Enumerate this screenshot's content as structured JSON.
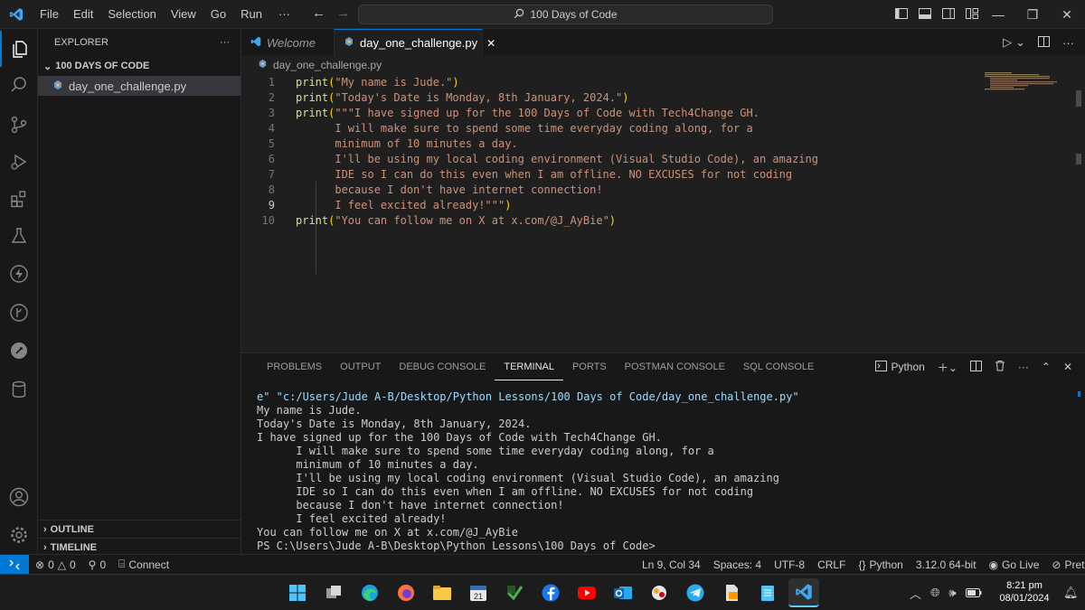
{
  "titlebar": {
    "menu": [
      "File",
      "Edit",
      "Selection",
      "View",
      "Go",
      "Run"
    ],
    "more": "···",
    "search_text": "100 Days of Code"
  },
  "sidebar": {
    "title": "EXPLORER",
    "more": "···",
    "folder": "100 DAYS OF CODE",
    "file": "day_one_challenge.py",
    "outline": "OUTLINE",
    "timeline": "TIMELINE"
  },
  "tabs": {
    "welcome": "Welcome",
    "active": "day_one_challenge.py",
    "close": "✕"
  },
  "breadcrumb": "day_one_challenge.py",
  "code": {
    "current_line": 9,
    "lines": [
      {
        "n": "1",
        "fn": "print",
        "open": "(",
        "str": "\"My name is Jude.\"",
        "close": ")"
      },
      {
        "n": "2",
        "fn": "print",
        "open": "(",
        "str": "\"Today's Date is Monday, 8th January, 2024.\"",
        "close": ")"
      },
      {
        "n": "3",
        "fn": "print",
        "open": "(",
        "str": "\"\"\"I have signed up for the 100 Days of Code with Tech4Change GH.",
        "close": ""
      },
      {
        "n": "4",
        "fn": "",
        "open": "",
        "str": "      I will make sure to spend some time everyday coding along, for a",
        "close": ""
      },
      {
        "n": "5",
        "fn": "",
        "open": "",
        "str": "      minimum of 10 minutes a day.",
        "close": ""
      },
      {
        "n": "6",
        "fn": "",
        "open": "",
        "str": "      I'll be using my local coding environment (Visual Studio Code), an amazing",
        "close": ""
      },
      {
        "n": "7",
        "fn": "",
        "open": "",
        "str": "      IDE so I can do this even when I am offline. NO EXCUSES for not coding",
        "close": ""
      },
      {
        "n": "8",
        "fn": "",
        "open": "",
        "str": "      because I don't have internet connection!",
        "close": ""
      },
      {
        "n": "9",
        "fn": "",
        "open": "",
        "str": "      I feel excited already!\"\"\"",
        "close": ")"
      },
      {
        "n": "10",
        "fn": "print",
        "open": "(",
        "str": "\"You can follow me on X at x.com/@J_AyBie\"",
        "close": ")"
      }
    ]
  },
  "panel": {
    "tabs": [
      "PROBLEMS",
      "OUTPUT",
      "DEBUG CONSOLE",
      "TERMINAL",
      "PORTS",
      "POSTMAN CONSOLE",
      "SQL CONSOLE"
    ],
    "active_tab": "TERMINAL",
    "terminal_profile": "Python",
    "terminal": [
      "e\" \"c:/Users/Jude A-B/Desktop/Python Lessons/100 Days of Code/day_one_challenge.py\"",
      "My name is Jude.",
      "Today's Date is Monday, 8th January, 2024.",
      "I have signed up for the 100 Days of Code with Tech4Change GH.",
      "      I will make sure to spend some time everyday coding along, for a",
      "      minimum of 10 minutes a day.",
      "      I'll be using my local coding environment (Visual Studio Code), an amazing",
      "      IDE so I can do this even when I am offline. NO EXCUSES for not coding",
      "      because I don't have internet connection!",
      "      I feel excited already!",
      "You can follow me on X at x.com/@J_AyBie",
      "PS C:\\Users\\Jude A-B\\Desktop\\Python Lessons\\100 Days of Code>"
    ]
  },
  "statusbar": {
    "errors": "0",
    "warnings": "0",
    "ports": "0",
    "connect": "Connect",
    "position": "Ln 9, Col 34",
    "spaces": "Spaces: 4",
    "encoding": "UTF-8",
    "eol": "CRLF",
    "language": "Python",
    "interpreter": "3.12.0 64-bit",
    "golive": "Go Live",
    "prettier": "Prettier"
  },
  "taskbar": {
    "time": "8:21 pm",
    "date": "08/01/2024",
    "calendar_day": "21"
  },
  "colors": {
    "accent": "#0078d4",
    "string": "#ce9178",
    "function": "#dcdcaa",
    "bracket": "#ffd700"
  }
}
